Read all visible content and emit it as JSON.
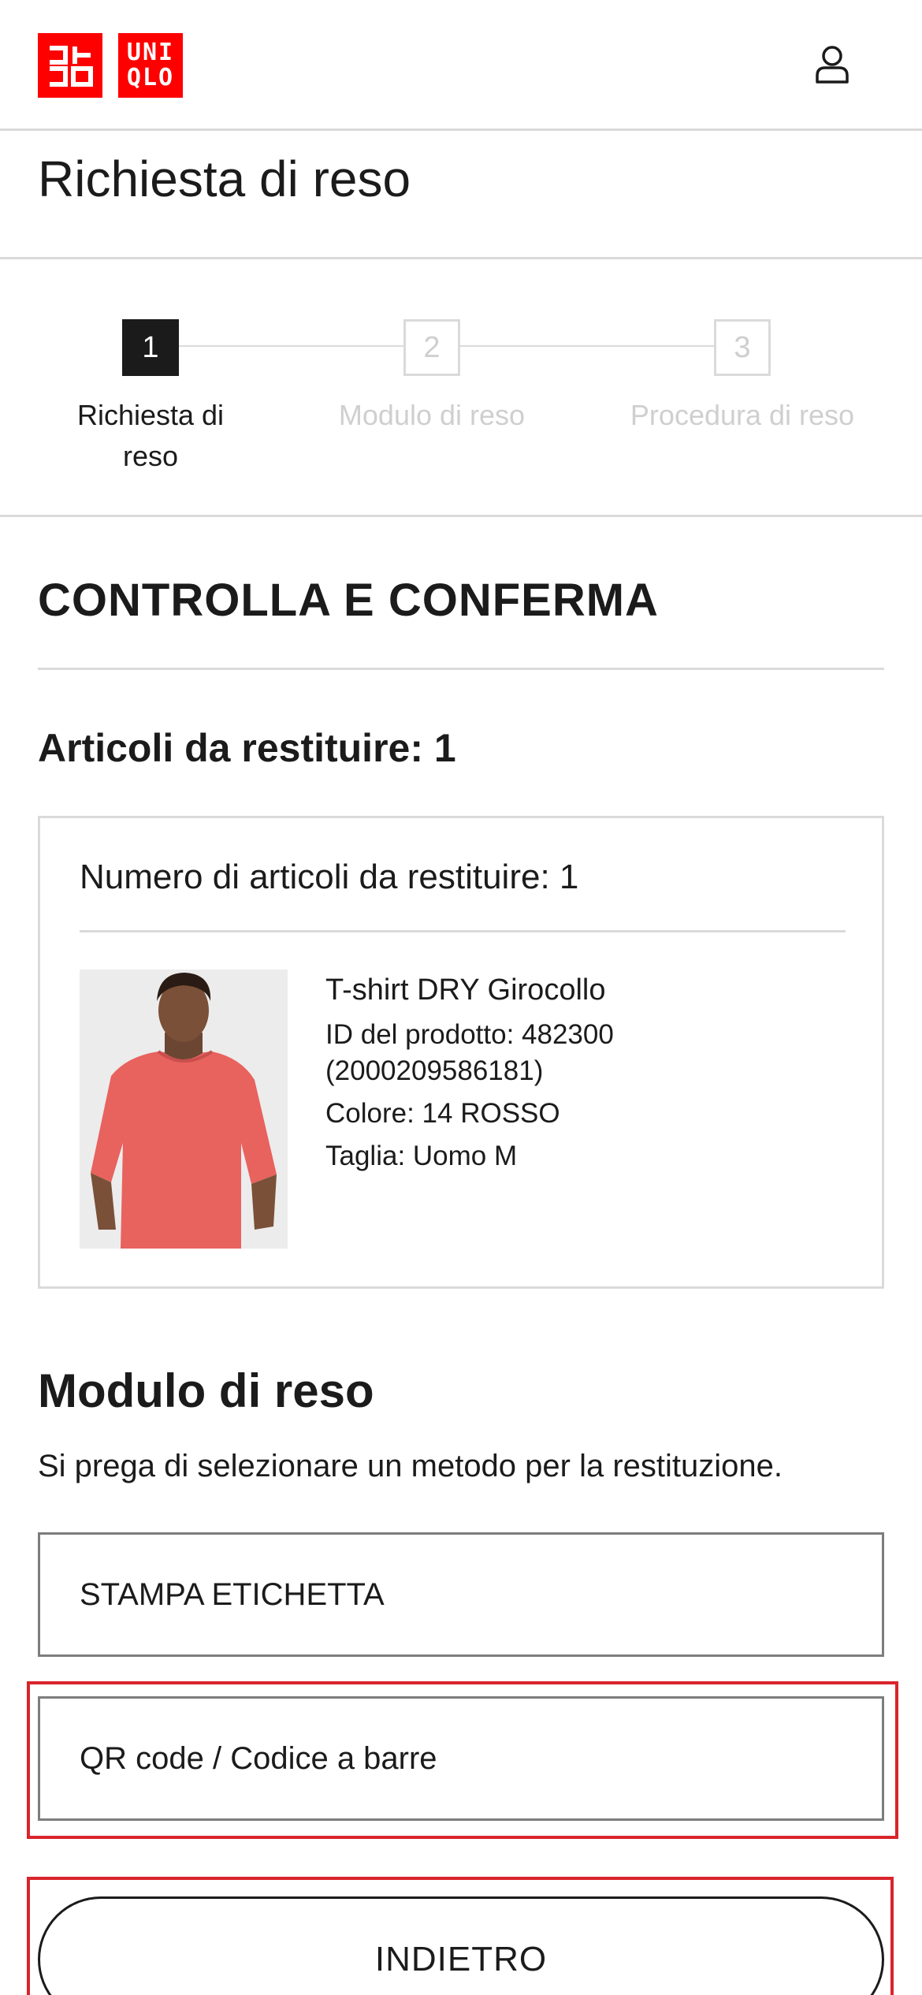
{
  "header": {
    "logo_text_left": "ユニクロ",
    "logo_line_1": "UNI",
    "logo_line_2": "QLO",
    "brand_color": "#ff0000",
    "account_icon": "user-icon"
  },
  "page": {
    "title": "Richiesta di reso"
  },
  "stepper": {
    "steps": [
      {
        "number": "1",
        "label": "Richiesta di reso",
        "state": "active"
      },
      {
        "number": "2",
        "label": "Modulo di reso",
        "state": "inactive"
      },
      {
        "number": "3",
        "label": "Procedura di reso",
        "state": "inactive"
      }
    ]
  },
  "review": {
    "section_title": "CONTROLLA E CONFERMA",
    "items_heading": "Articoli da restituire: 1",
    "card_heading": "Numero di articoli da restituire: 1",
    "product": {
      "name": "T-shirt DRY Girocollo",
      "id_line": "ID del prodotto: 482300",
      "barcode_line": "(2000209586181)",
      "color_line": "Colore: 14 ROSSO",
      "size_line": "Taglia: Uomo M",
      "shirt_color": "#e8625e"
    }
  },
  "return_form": {
    "title": "Modulo di reso",
    "description": "Si prega di selezionare un metodo per la restituzione.",
    "options": [
      {
        "label": "STAMPA ETICHETTA"
      },
      {
        "label": "QR code / Codice a barre"
      }
    ],
    "highlight_color": "#d9242b"
  },
  "actions": {
    "back_label": "INDIETRO"
  }
}
